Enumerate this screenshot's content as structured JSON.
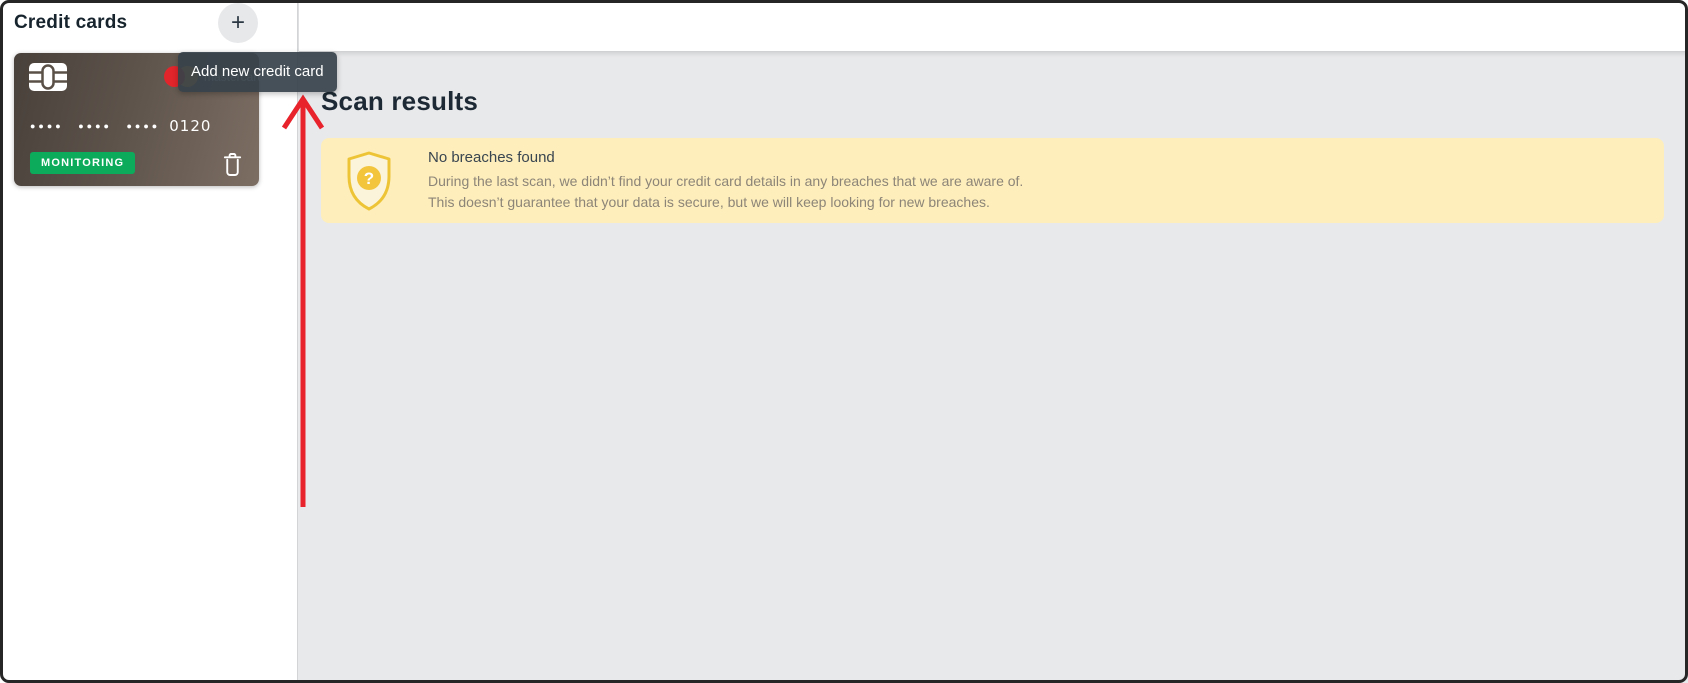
{
  "sidebar": {
    "title": "Credit cards",
    "add_button": {
      "icon": "+",
      "tooltip": "Add new credit card"
    },
    "card": {
      "masked_dots": "●●●● ●●●● ●●●●",
      "last4": "0120",
      "status": "MONITORING",
      "brand": "mastercard",
      "shield_glyph": "?"
    }
  },
  "main": {
    "heading": "Scan results",
    "notice": {
      "title": "No breaches found",
      "line1": "During the last scan, we didn’t find your credit card details in any breaches that we are aware of.",
      "line2": "This doesn’t guarantee that your data is secure, but we will keep looking for new breaches."
    }
  },
  "colors": {
    "badge_green": "#0cab5c",
    "notice_bg": "#fdeebc",
    "arrow_red": "#e8232b",
    "mastercard_red": "#e2252b",
    "mastercard_orange": "#f79e1b",
    "card_gradient_start": "#48403a",
    "card_gradient_end": "#7d6e63"
  }
}
